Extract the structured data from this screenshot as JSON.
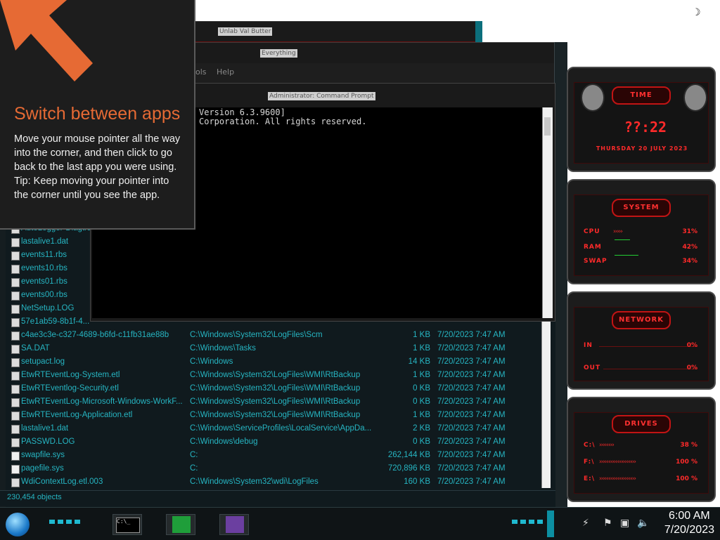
{
  "tip": {
    "title": "Switch between apps",
    "body": "Move your mouse pointer all the way into the corner, and then click to go back to the last app you were using.",
    "hint": "Tip: Keep moving your pointer into the corner until you see the app."
  },
  "windows": {
    "back1_title": "Unlab Val Butter",
    "back2_title": "Everything",
    "back2_menu_1": "ols",
    "back2_menu_2": "Help",
    "cmd_title": "Administrator: Command Prompt"
  },
  "cmd": {
    "line1": "Version 6.3.9600]",
    "line2": "Corporation. All rights reserved."
  },
  "files": [
    {
      "name": "AutoLogger-Diagtrack-Listener.etl",
      "path": "",
      "size": "",
      "date": "",
      "icon": "doc"
    },
    {
      "name": "lastalive1.dat",
      "path": "",
      "size": "",
      "date": "",
      "icon": "doc"
    },
    {
      "name": "events11.rbs",
      "path": "",
      "size": "",
      "date": "",
      "icon": "doc"
    },
    {
      "name": "events10.rbs",
      "path": "",
      "size": "",
      "date": "",
      "icon": "doc"
    },
    {
      "name": "events01.rbs",
      "path": "",
      "size": "",
      "date": "",
      "icon": "doc"
    },
    {
      "name": "events00.rbs",
      "path": "",
      "size": "",
      "date": "",
      "icon": "doc"
    },
    {
      "name": "NetSetup.LOG",
      "path": "",
      "size": "",
      "date": "",
      "icon": "doc"
    },
    {
      "name": "57e1ab59-8b1f-4...",
      "path": "",
      "size": "",
      "date": "",
      "icon": "doc"
    },
    {
      "name": "c4ae3c3e-c327-4689-b6fd-c11fb31ae88b",
      "path": "C:\\Windows\\System32\\LogFiles\\Scm",
      "size": "1 KB",
      "date": "7/20/2023 7:47 AM",
      "icon": "doc"
    },
    {
      "name": "SA.DAT",
      "path": "C:\\Windows\\Tasks",
      "size": "1 KB",
      "date": "7/20/2023 7:47 AM",
      "icon": "doc"
    },
    {
      "name": "setupact.log",
      "path": "C:\\Windows",
      "size": "14 KB",
      "date": "7/20/2023 7:47 AM",
      "icon": "doc"
    },
    {
      "name": "EtwRTEventLog-System.etl",
      "path": "C:\\Windows\\System32\\LogFiles\\WMI\\RtBackup",
      "size": "1 KB",
      "date": "7/20/2023 7:47 AM",
      "icon": "doc"
    },
    {
      "name": "EtwRTEventlog-Security.etl",
      "path": "C:\\Windows\\System32\\LogFiles\\WMI\\RtBackup",
      "size": "0 KB",
      "date": "7/20/2023 7:47 AM",
      "icon": "doc"
    },
    {
      "name": "EtwRTEventLog-Microsoft-Windows-WorkF...",
      "path": "C:\\Windows\\System32\\LogFiles\\WMI\\RtBackup",
      "size": "0 KB",
      "date": "7/20/2023 7:47 AM",
      "icon": "doc"
    },
    {
      "name": "EtwRTEventLog-Application.etl",
      "path": "C:\\Windows\\System32\\LogFiles\\WMI\\RtBackup",
      "size": "1 KB",
      "date": "7/20/2023 7:47 AM",
      "icon": "doc"
    },
    {
      "name": "lastalive1.dat",
      "path": "C:\\Windows\\ServiceProfiles\\LocalService\\AppDa...",
      "size": "2 KB",
      "date": "7/20/2023 7:47 AM",
      "icon": "doc"
    },
    {
      "name": "PASSWD.LOG",
      "path": "C:\\Windows\\debug",
      "size": "0 KB",
      "date": "7/20/2023 7:47 AM",
      "icon": "doc"
    },
    {
      "name": "swapfile.sys",
      "path": "C:",
      "size": "262,144 KB",
      "date": "7/20/2023 7:47 AM",
      "icon": "sys"
    },
    {
      "name": "pagefile.sys",
      "path": "C:",
      "size": "720,896 KB",
      "date": "7/20/2023 7:47 AM",
      "icon": "sys"
    },
    {
      "name": "WdiContextLog.etl.003",
      "path": "C:\\Windows\\System32\\wdi\\LogFiles",
      "size": "160 KB",
      "date": "7/20/2023 7:47 AM",
      "icon": "doc"
    }
  ],
  "status": "230,454 objects",
  "gadgets": {
    "time_tag": "TIME",
    "time_value": "??:22",
    "date_value": "THURSDAY 20 JULY 2023",
    "system_tag": "SYSTEM",
    "cpu_label": "CPU",
    "cpu_value": "31%",
    "ram_label": "RAM",
    "ram_value": "42%",
    "swap_label": "SWAP",
    "swap_value": "34%",
    "network_tag": "NETWORK",
    "in_label": "IN",
    "in_value": "0%",
    "out_label": "OUT",
    "out_value": "0%",
    "drives_tag": "DRIVES",
    "c_label": "C:\\",
    "c_value": "38 %",
    "f_label": "F:\\",
    "f_value": "100 %",
    "e_label": "E:\\",
    "e_value": "100 %"
  },
  "taskbar": {
    "cmd_label": "C:\\_",
    "time": "6:00 AM",
    "date": "7/20/2023"
  },
  "colors": {
    "accent": "#26b5c2",
    "tip_title": "#e66a34",
    "gadget_red": "#ff2a2a"
  },
  "icons": {
    "night": "moon-icon",
    "start": "start-orb-icon",
    "volume": "speaker-icon"
  }
}
